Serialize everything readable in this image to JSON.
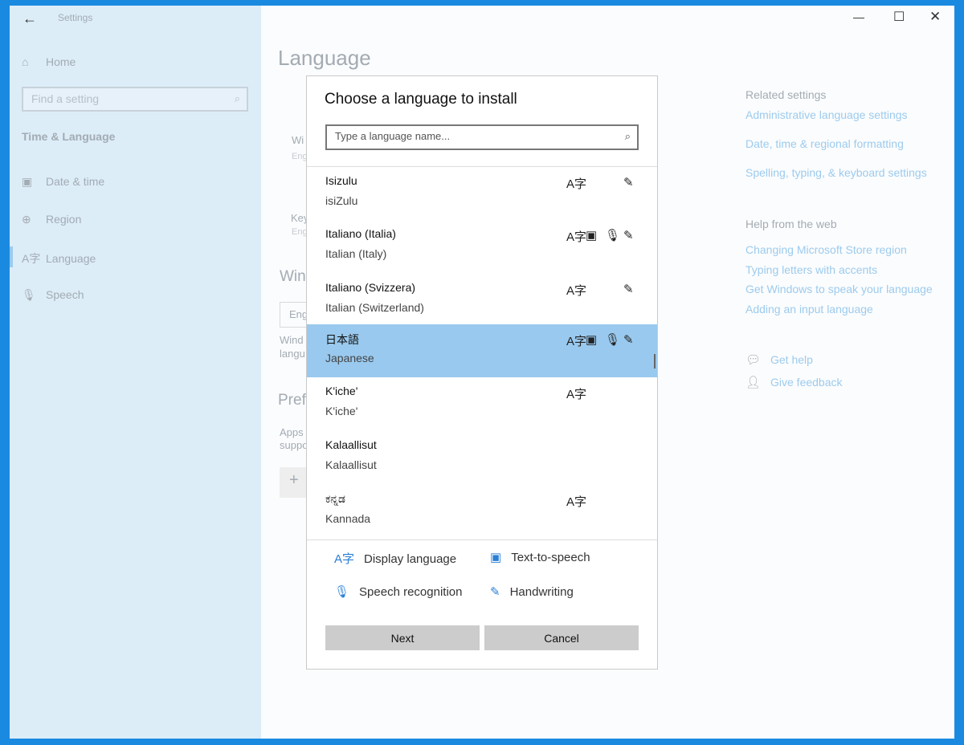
{
  "window": {
    "title": "Settings"
  },
  "sidebar": {
    "home": "Home",
    "search_placeholder": "Find a setting",
    "section": "Time & Language",
    "items": [
      {
        "label": "Date & time",
        "icon": "calendar-clock-icon"
      },
      {
        "label": "Region",
        "icon": "globe-icon"
      },
      {
        "label": "Language",
        "icon": "language-icon"
      },
      {
        "label": "Speech",
        "icon": "microphone-icon"
      }
    ]
  },
  "main": {
    "title": "Language",
    "bg_fragments": [
      "Wi",
      "Eng",
      "Key",
      "Eng",
      "Win",
      "Eng",
      "Wind",
      "langu",
      "Pref",
      "Apps",
      "suppo",
      "+"
    ]
  },
  "related": {
    "heading": "Related settings",
    "links": [
      "Administrative language settings",
      "Date, time & regional formatting",
      "Spelling, typing, & keyboard settings"
    ],
    "help_heading": "Help from the web",
    "help_links": [
      "Changing Microsoft Store region",
      "Typing letters with accents",
      "Get Windows to speak your language",
      "Adding an input language"
    ],
    "get_help": "Get help",
    "feedback": "Give feedback"
  },
  "dialog": {
    "title": "Choose a language to install",
    "search_placeholder": "Type a language name...",
    "languages": [
      {
        "name": "Isizulu",
        "english": "isiZulu",
        "display": true,
        "tts": false,
        "speech": false,
        "handwriting": true
      },
      {
        "name": "Italiano (Italia)",
        "english": "Italian (Italy)",
        "display": true,
        "tts": true,
        "speech": true,
        "handwriting": true
      },
      {
        "name": "Italiano (Svizzera)",
        "english": "Italian (Switzerland)",
        "display": true,
        "tts": false,
        "speech": false,
        "handwriting": true
      },
      {
        "name": "日本語",
        "english": "Japanese",
        "display": true,
        "tts": true,
        "speech": true,
        "handwriting": true,
        "selected": true
      },
      {
        "name": "K'iche'",
        "english": "K'iche'",
        "display": true,
        "tts": false,
        "speech": false,
        "handwriting": false
      },
      {
        "name": "Kalaallisut",
        "english": "Kalaallisut",
        "display": false,
        "tts": false,
        "speech": false,
        "handwriting": false
      },
      {
        "name": "ಕನ್ನಡ",
        "english": "Kannada",
        "display": true,
        "tts": false,
        "speech": false,
        "handwriting": false
      }
    ],
    "legend": {
      "display": "Display language",
      "tts": "Text-to-speech",
      "speech": "Speech recognition",
      "handwriting": "Handwriting"
    },
    "next": "Next",
    "cancel": "Cancel"
  },
  "colors": {
    "accent": "#0078d7",
    "selected": "#99c9ee",
    "link": "#9ccbee"
  }
}
